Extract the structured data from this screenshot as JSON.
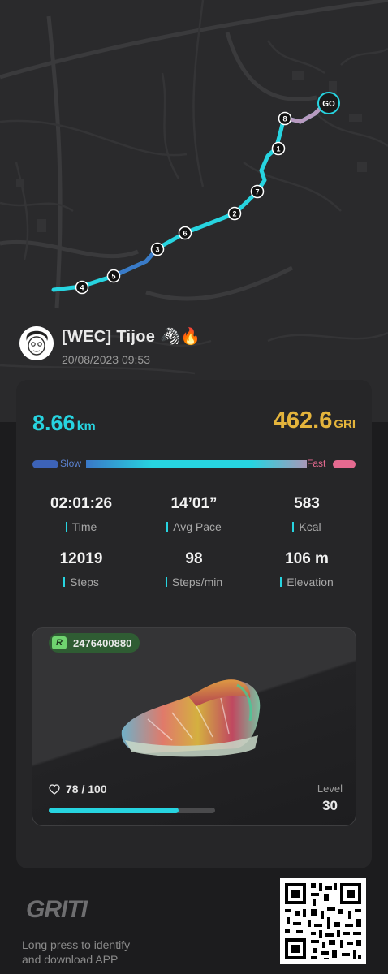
{
  "map": {
    "start_marker": "GO",
    "route_markers": [
      "1",
      "2",
      "3",
      "4",
      "5",
      "6",
      "7",
      "8"
    ]
  },
  "user": {
    "name": "[WEC] Tijoe 🦓🔥",
    "datetime": "20/08/2023 09:53",
    "avatar_icon": "avatar-illustration"
  },
  "summary": {
    "distance_value": "8.66",
    "distance_unit": "km",
    "gri_value": "462.6",
    "gri_unit": "GRI"
  },
  "speed_bar": {
    "slow_label": "Slow",
    "fast_label": "Fast"
  },
  "stats": [
    {
      "value": "02:01:26",
      "label": "Time"
    },
    {
      "value": "14’01”",
      "label": "Avg Pace"
    },
    {
      "value": "583",
      "label": "Kcal"
    },
    {
      "value": "12019",
      "label": "Steps"
    },
    {
      "value": "98",
      "label": "Steps/min"
    },
    {
      "value": "106 m",
      "label": "Elevation"
    }
  ],
  "shoe": {
    "badge_letter": "R",
    "id": "2476400880",
    "durability_text": "78 / 100",
    "durability_fraction": 0.78,
    "level_label": "Level",
    "level_value": "30"
  },
  "footer": {
    "logo_text": "GRITI",
    "press_line1": "Long press to identify",
    "press_line2": "and download APP"
  },
  "colors": {
    "accent": "#27d4e0",
    "gri": "#e4b43c",
    "slow": "#3d63b8",
    "fast": "#e56a90"
  }
}
